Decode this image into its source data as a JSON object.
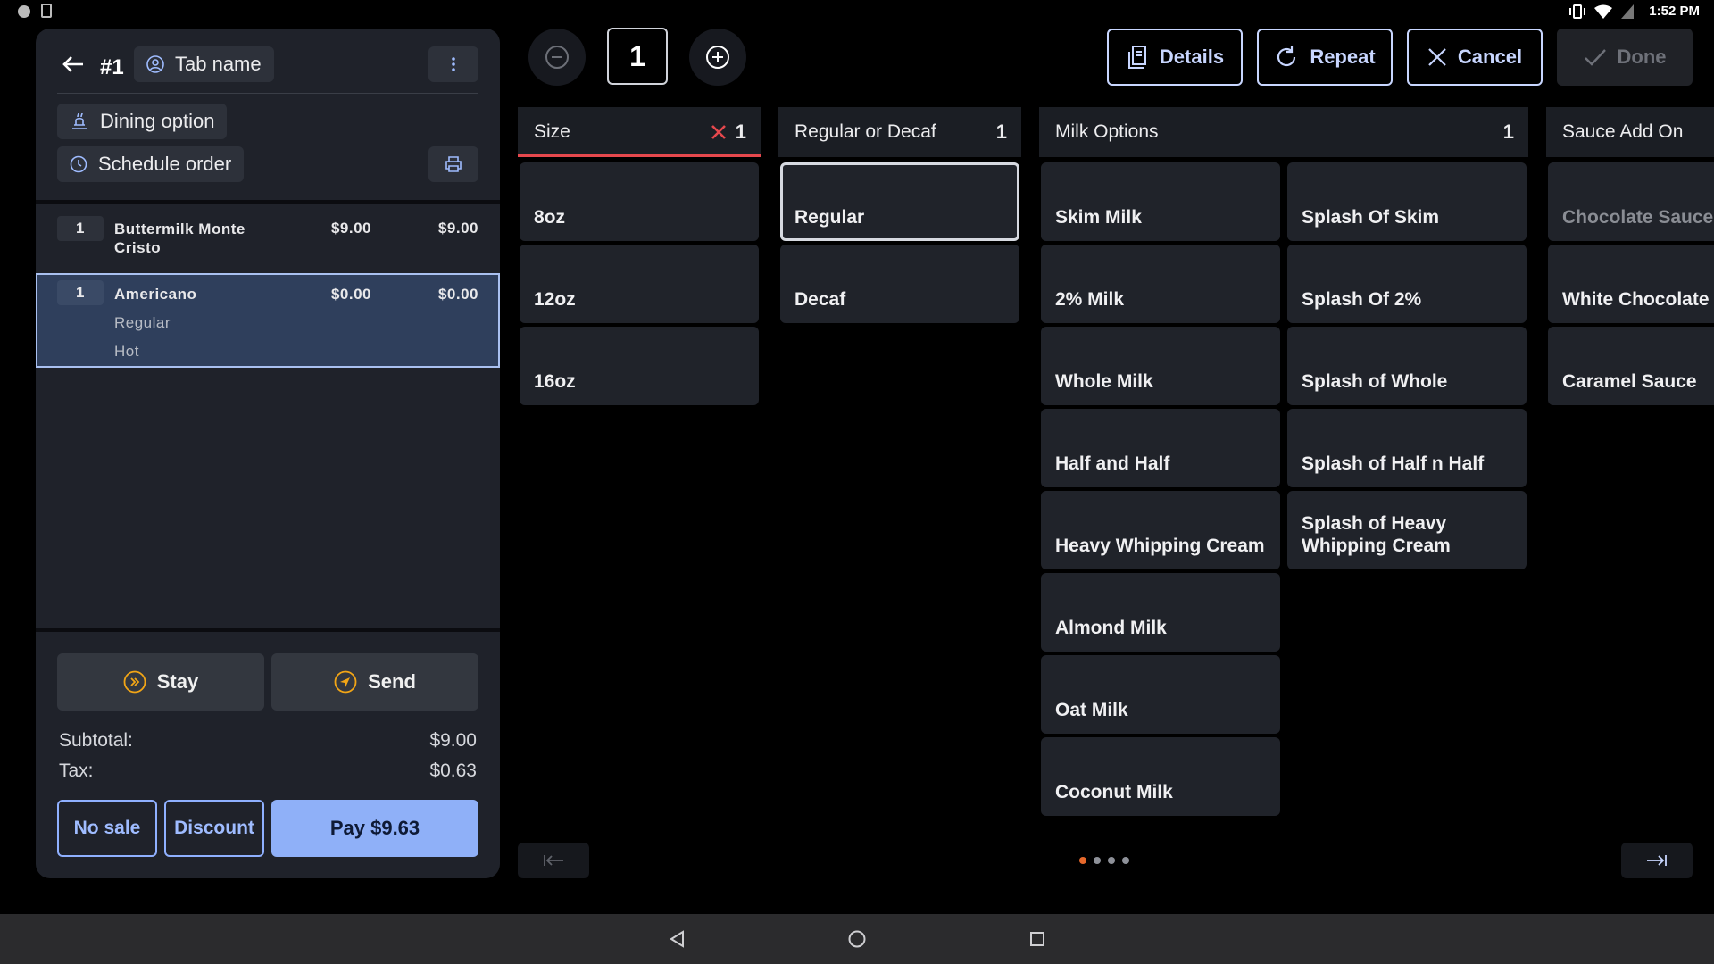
{
  "status_bar": {
    "time": "1:52 PM"
  },
  "order": {
    "number": "#1",
    "tab_name": "Tab name",
    "dining_option": "Dining option",
    "schedule_order": "Schedule order",
    "lines": [
      {
        "qty": "1",
        "name": "Buttermilk Monte Cristo",
        "price": "$9.00",
        "total": "$9.00",
        "modifiers": []
      },
      {
        "qty": "1",
        "name": "Americano",
        "price": "$0.00",
        "total": "$0.00",
        "modifiers": [
          "Regular",
          "Hot"
        ],
        "selected": true
      }
    ],
    "stay_label": "Stay",
    "send_label": "Send",
    "subtotal_label": "Subtotal:",
    "subtotal_value": "$9.00",
    "tax_label": "Tax:",
    "tax_value": "$0.63",
    "no_sale_label": "No sale",
    "discount_label": "Discount",
    "pay_label": "Pay $9.63"
  },
  "toolbar": {
    "quantity": "1",
    "details_label": "Details",
    "repeat_label": "Repeat",
    "cancel_label": "Cancel",
    "done_label": "Done"
  },
  "modifier_groups": [
    {
      "title": "Size",
      "count": "1",
      "required_error": true,
      "options": [
        "8oz",
        "12oz",
        "16oz"
      ]
    },
    {
      "title": "Regular or Decaf",
      "count": "1",
      "options": [
        "Regular",
        "Decaf"
      ],
      "selected": "Regular"
    },
    {
      "title": "Milk Options",
      "count": "1",
      "options": [
        "Skim Milk",
        "2% Milk",
        "Whole Milk",
        "Half and Half",
        "Heavy Whipping Cream",
        "Almond Milk",
        "Oat Milk",
        "Coconut Milk",
        "Splash Of Skim",
        "Splash Of 2%",
        "Splash of Whole",
        "Splash of Half n Half",
        "Splash of Heavy Whipping Cream"
      ]
    },
    {
      "title": "Sauce Add On",
      "options": [
        "Chocolate Sauce",
        "White Chocolate Sauce",
        "Caramel Sauce"
      ],
      "disabled": [
        "Chocolate Sauce"
      ]
    }
  ],
  "pagination": {
    "pages": 4,
    "current": 1
  },
  "colors": {
    "accent_blue": "#8fb0f8",
    "error_red": "#e5484d",
    "icon_orange": "#f2a516"
  },
  "icons": [
    "back-arrow-icon",
    "person-icon",
    "more-vertical-icon",
    "dining-icon",
    "clock-icon",
    "printer-icon",
    "minus-circle-icon",
    "plus-circle-icon",
    "details-icon",
    "repeat-icon",
    "close-icon",
    "check-icon",
    "stay-icon",
    "send-icon",
    "page-first-icon",
    "page-last-icon"
  ]
}
